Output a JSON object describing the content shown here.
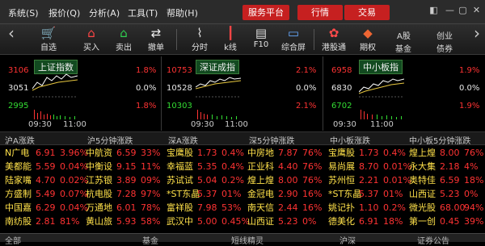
{
  "menu": {
    "items": [
      "系统",
      "报价",
      "分析",
      "工具",
      "帮助"
    ],
    "service": "服务平台",
    "trade": "行情",
    "deal": "交易"
  },
  "toolbar": {
    "buttons": [
      "自选",
      "买入",
      "卖出",
      "撤单",
      "分时",
      "k线",
      "F10",
      "综合屏",
      "港股通",
      "期权"
    ],
    "links": {
      "a": "A股",
      "a2": "基金",
      "b": "创业",
      "b2": "债券"
    }
  },
  "panels": [
    {
      "title": "上证指数",
      "top": "3106",
      "mid": "3051",
      "bot": "2995",
      "pct_top": "1.8%",
      "pct_mid": "0.0%",
      "pct_bot": "1.8%",
      "t1": "09:30",
      "t2": "11:00"
    },
    {
      "title": "深证成指",
      "top": "10753",
      "mid": "10528",
      "bot": "10303",
      "pct_top": "2.1%",
      "pct_mid": "0.0%",
      "pct_bot": "2.1%",
      "t1": "09:30",
      "t2": "11:00"
    },
    {
      "title": "中小板指",
      "top": "6958",
      "mid": "6830",
      "bot": "6702",
      "pct_top": "1.9%",
      "pct_mid": "0.0%",
      "pct_bot": "1.9%",
      "t1": "09:30",
      "t2": "11:00"
    }
  ],
  "sections": [
    "沪A涨跌",
    "沪5分钟涨跌",
    "深A涨跌",
    "深5分钟涨跌",
    "中小板涨跌",
    "中小板5分钟涨跌"
  ],
  "lists": [
    [
      [
        "N广电",
        "6.91",
        "3.96%"
      ],
      [
        "美都能",
        "5.59",
        "0.04%"
      ],
      [
        "陆家嘴",
        "4.70",
        "0.02%"
      ],
      [
        "方盛制",
        "5.49",
        "0.07%"
      ],
      [
        "中国嘉",
        "6.29",
        "0.04%"
      ],
      [
        "南纺股",
        "2.81",
        "81%"
      ]
    ],
    [
      [
        "中航资",
        "6.59",
        "33%"
      ],
      [
        "中衡设",
        "9.15",
        "11%"
      ],
      [
        "江苏银",
        "3.89",
        "09%"
      ],
      [
        "杭电股",
        "7.28",
        "97%"
      ],
      [
        "万通地",
        "6.01",
        "78%"
      ],
      [
        "黄山旅",
        "5.93",
        "58%"
      ]
    ],
    [
      [
        "宝鹰股",
        "1.73",
        "0.4%"
      ],
      [
        "幸福蓝",
        "5.35",
        "0.4%"
      ],
      [
        "苏试试",
        "5.04",
        "0.2%"
      ],
      [
        "*ST东晶",
        "5.37",
        "01%"
      ],
      [
        "富祥股",
        "7.98",
        "53%"
      ],
      [
        "武汉中",
        "5.00",
        "0.45%"
      ]
    ],
    [
      [
        "中房地",
        "7.87",
        "76%"
      ],
      [
        "正业科",
        "4.40",
        "76%"
      ],
      [
        "煌上煌",
        "8.00",
        "76%"
      ],
      [
        "金冠电",
        "2.90",
        "16%"
      ],
      [
        "南天信",
        "2.44",
        "16%"
      ],
      [
        "山西证",
        "5.23",
        "0%"
      ]
    ],
    [
      [
        "宝鹰股",
        "1.73",
        "0.4%"
      ],
      [
        "易尚展",
        "8.70",
        "0.01%"
      ],
      [
        "苏州恒",
        "2.21",
        "0.01%"
      ],
      [
        "*ST东晶",
        "5.37",
        "01%"
      ],
      [
        "姚记扑",
        "1.10",
        "0.2%"
      ],
      [
        "德美化",
        "6.91",
        "18%"
      ]
    ],
    [
      [
        "煌上煌",
        "8.00",
        "76%"
      ],
      [
        "永大集",
        "2.18",
        "4%"
      ],
      [
        "奥特佳",
        "6.59",
        "18%"
      ],
      [
        "山西证",
        "5.23",
        "0%"
      ],
      [
        "微光股",
        "68.00",
        "94%"
      ],
      [
        "第一创",
        "0.45",
        "39%"
      ]
    ]
  ],
  "bottom": [
    "全部",
    "基金",
    "短线精灵",
    "沪深",
    "证券公告"
  ],
  "colors": {
    "up": "#ff3333",
    "down": "#33dd33",
    "accent": "#c62020"
  }
}
